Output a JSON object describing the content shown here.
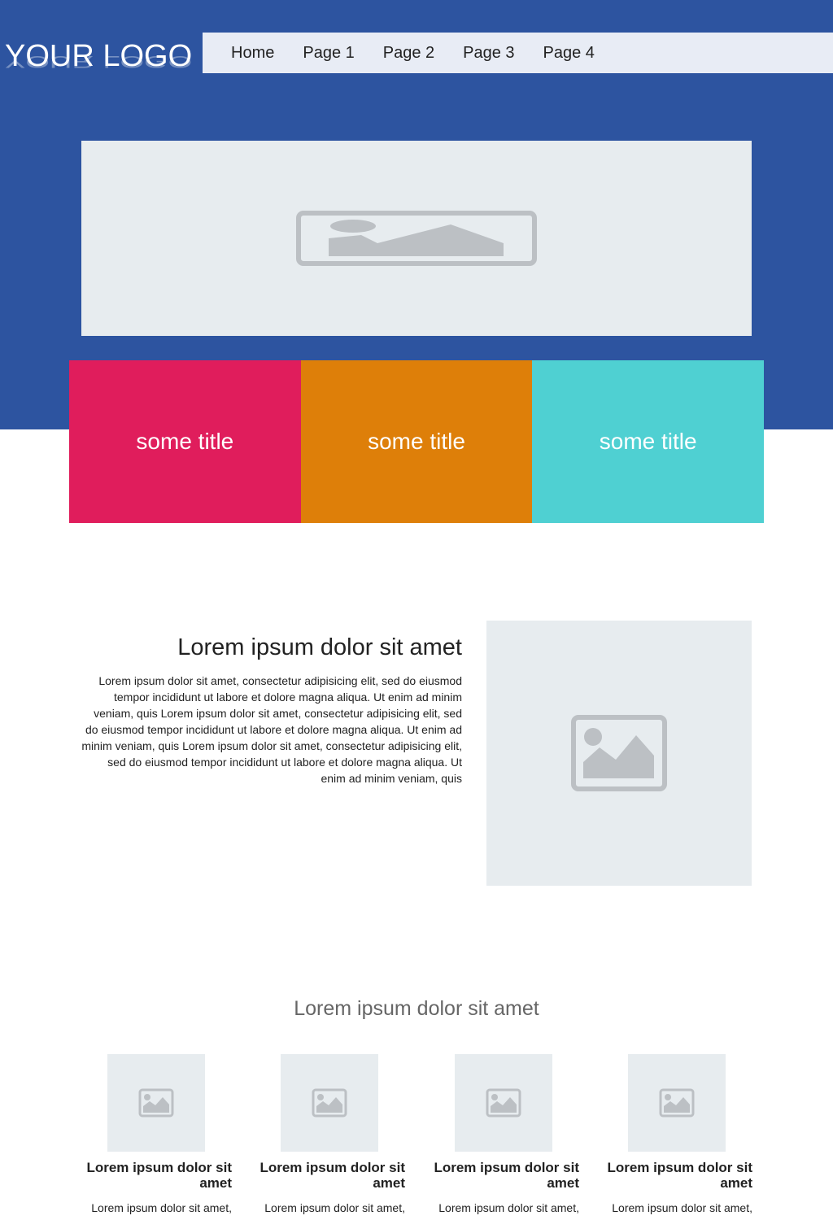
{
  "header": {
    "logo_text": "YOUR LOGO",
    "nav": [
      "Home",
      "Page 1",
      "Page 2",
      "Page 3",
      "Page 4"
    ]
  },
  "banner": {
    "icon": "image-placeholder-icon"
  },
  "tiles": [
    {
      "title": "some title",
      "color": "#e01d5c"
    },
    {
      "title": "some title",
      "color": "#de7f09"
    },
    {
      "title": "some title",
      "color": "#4fd0d2"
    }
  ],
  "feature": {
    "title": "Lorem ipsum dolor sit amet",
    "body": "Lorem ipsum dolor sit amet, consectetur adipisicing elit, sed do eiusmod tempor incididunt ut labore et dolore magna aliqua. Ut enim ad minim veniam, quis Lorem ipsum dolor sit amet, consectetur adipisicing elit, sed do eiusmod tempor incididunt ut labore et dolore magna aliqua. Ut enim ad minim veniam, quis Lorem ipsum dolor sit amet, consectetur adipisicing elit, sed do eiusmod tempor incididunt ut labore et dolore magna aliqua. Ut enim ad minim veniam, quis"
  },
  "section": {
    "title": "Lorem ipsum dolor sit amet",
    "cards": [
      {
        "title": "Lorem ipsum dolor sit amet",
        "text": "Lorem ipsum dolor sit amet,"
      },
      {
        "title": "Lorem ipsum dolor sit amet",
        "text": "Lorem ipsum dolor sit amet,"
      },
      {
        "title": "Lorem ipsum dolor sit amet",
        "text": "Lorem ipsum dolor sit amet,"
      },
      {
        "title": "Lorem ipsum dolor sit amet",
        "text": "Lorem ipsum dolor sit amet,"
      }
    ]
  },
  "colors": {
    "brand": "#2d54a0",
    "nav_bg": "#e8ecf5",
    "placeholder": "#e7ecef"
  }
}
